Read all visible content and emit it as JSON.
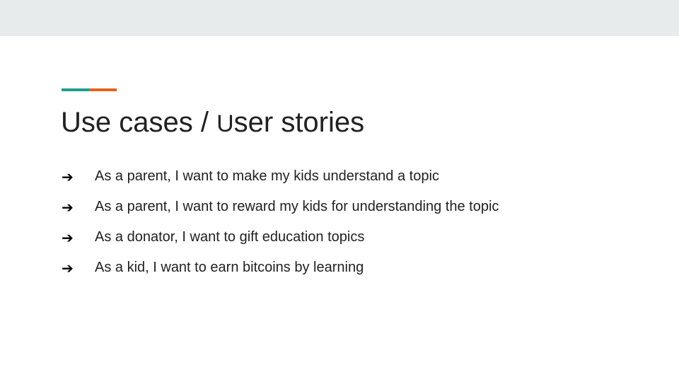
{
  "slide": {
    "title_part1": "Use cases / ",
    "title_part2": "U",
    "title_part3": "ser stories",
    "bullet_icon": "right-arrow",
    "bullet_glyph": "➔",
    "bullets": [
      "As a parent, I want to make my kids understand a topic",
      "As a parent, I want to reward my kids for understanding the topic",
      "As a donator, I want to gift education topics",
      "As a kid, I want to earn bitcoins by learning"
    ]
  },
  "colors": {
    "accent_teal": "#1f9e8f",
    "accent_orange": "#e4631a",
    "top_bar": "#e8ebec",
    "text": "#212121"
  }
}
